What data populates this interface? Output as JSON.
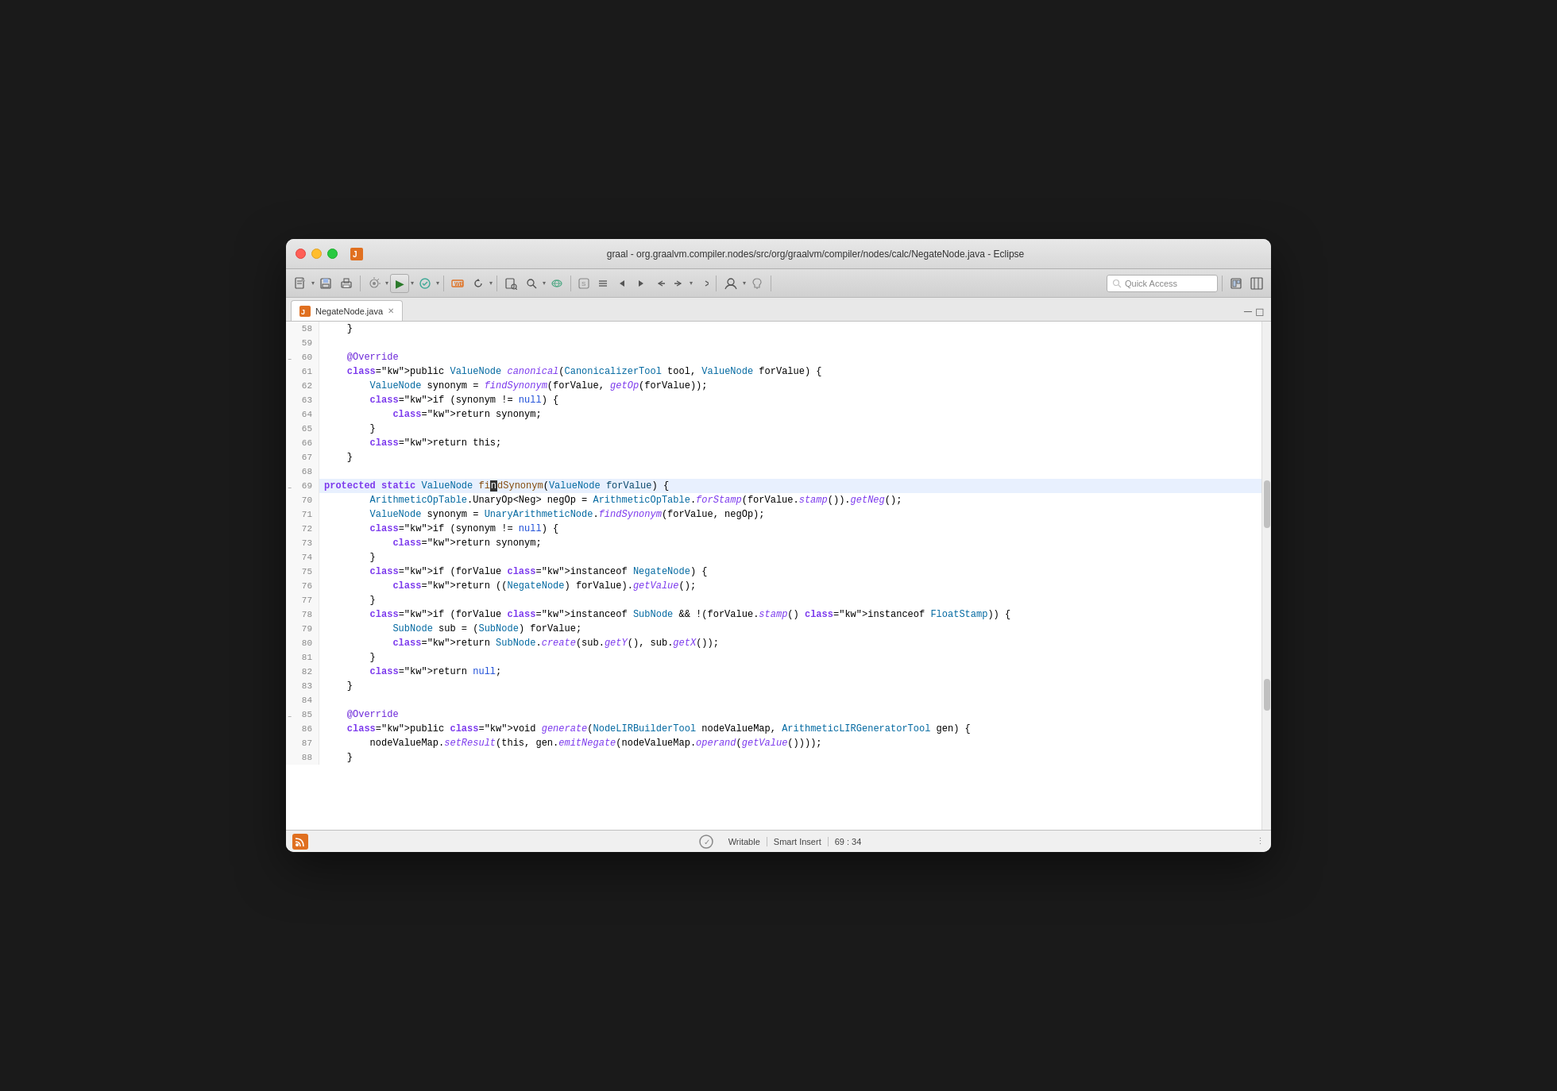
{
  "window": {
    "title": "graal - org.graalvm.compiler.nodes/src/org/graalvm/compiler/nodes/calc/NegateNode.java - Eclipse"
  },
  "toolbar": {
    "quick_access_placeholder": "Quick Access"
  },
  "tab": {
    "filename": "NegateNode.java",
    "close_icon": "✕"
  },
  "status_bar": {
    "writable": "Writable",
    "smart_insert": "Smart Insert",
    "position": "69 : 34"
  },
  "code_lines": [
    {
      "num": "58",
      "content": "    }",
      "highlight": false
    },
    {
      "num": "59",
      "content": "",
      "highlight": false
    },
    {
      "num": "60",
      "content": "    @Override",
      "highlight": false,
      "collapse": true
    },
    {
      "num": "61",
      "content": "    public ValueNode canonical(CanonicalizerTool tool, ValueNode forValue) {",
      "highlight": false,
      "arrow": true
    },
    {
      "num": "62",
      "content": "        ValueNode synonym = findSynonym(forValue, getOp(forValue));",
      "highlight": false
    },
    {
      "num": "63",
      "content": "        if (synonym != null) {",
      "highlight": false
    },
    {
      "num": "64",
      "content": "            return synonym;",
      "highlight": false
    },
    {
      "num": "65",
      "content": "        }",
      "highlight": false
    },
    {
      "num": "66",
      "content": "        return this;",
      "highlight": false
    },
    {
      "num": "67",
      "content": "    }",
      "highlight": false
    },
    {
      "num": "68",
      "content": "",
      "highlight": false
    },
    {
      "num": "69",
      "content": "    protected static ValueNode findSynonym(ValueNode forValue) {",
      "highlight": true,
      "collapse": true
    },
    {
      "num": "70",
      "content": "        ArithmeticOpTable.UnaryOp<Neg> negOp = ArithmeticOpTable.forStamp(forValue.stamp()).getNeg();",
      "highlight": false
    },
    {
      "num": "71",
      "content": "        ValueNode synonym = UnaryArithmeticNode.findSynonym(forValue, negOp);",
      "highlight": false
    },
    {
      "num": "72",
      "content": "        if (synonym != null) {",
      "highlight": false
    },
    {
      "num": "73",
      "content": "            return synonym;",
      "highlight": false
    },
    {
      "num": "74",
      "content": "        }",
      "highlight": false
    },
    {
      "num": "75",
      "content": "        if (forValue instanceof NegateNode) {",
      "highlight": false
    },
    {
      "num": "76",
      "content": "            return ((NegateNode) forValue).getValue();",
      "highlight": false
    },
    {
      "num": "77",
      "content": "        }",
      "highlight": false
    },
    {
      "num": "78",
      "content": "        if (forValue instanceof SubNode && !(forValue.stamp() instanceof FloatStamp)) {",
      "highlight": false
    },
    {
      "num": "79",
      "content": "            SubNode sub = (SubNode) forValue;",
      "highlight": false
    },
    {
      "num": "80",
      "content": "            return SubNode.create(sub.getY(), sub.getX());",
      "highlight": false
    },
    {
      "num": "81",
      "content": "        }",
      "highlight": false
    },
    {
      "num": "82",
      "content": "        return null;",
      "highlight": false
    },
    {
      "num": "83",
      "content": "    }",
      "highlight": false
    },
    {
      "num": "84",
      "content": "",
      "highlight": false
    },
    {
      "num": "85",
      "content": "    @Override",
      "highlight": false,
      "collapse": true
    },
    {
      "num": "86",
      "content": "    public void generate(NodeLIRBuilderTool nodeValueMap, ArithmeticLIRGeneratorTool gen) {",
      "highlight": false,
      "arrow": true
    },
    {
      "num": "87",
      "content": "        nodeValueMap.setResult(this, gen.emitNegate(nodeValueMap.operand(getValue())));",
      "highlight": false
    },
    {
      "num": "88",
      "content": "    }",
      "highlight": false
    }
  ]
}
